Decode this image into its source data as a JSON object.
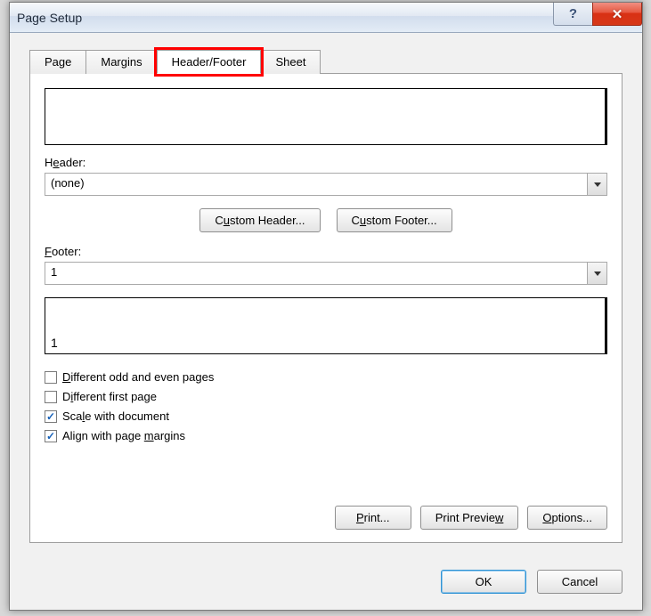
{
  "window": {
    "title": "Page Setup"
  },
  "tabs": {
    "page": "Page",
    "margins": "Margins",
    "header_footer": "Header/Footer",
    "sheet": "Sheet"
  },
  "header": {
    "label_pre": "H",
    "label_u": "e",
    "label_post": "ader:",
    "value": "(none)"
  },
  "custom_header": {
    "pre": "C",
    "u": "u",
    "post": "stom Header..."
  },
  "custom_footer": {
    "pre": "C",
    "u": "u",
    "post": "stom Footer..."
  },
  "footer": {
    "label_pre": "",
    "label_u": "F",
    "label_post": "ooter:",
    "value": "1",
    "preview": "1"
  },
  "checkboxes": {
    "diff_odd_even": {
      "pre": "",
      "u": "D",
      "post": "ifferent odd and even pages",
      "checked": false
    },
    "diff_first": {
      "pre": "D",
      "u": "i",
      "post": "fferent first page",
      "checked": false
    },
    "scale_doc": {
      "pre": "Sca",
      "u": "l",
      "post": "e with document",
      "checked": true
    },
    "align_margins": {
      "pre": "Align with page ",
      "u": "m",
      "post": "argins",
      "checked": true
    }
  },
  "buttons": {
    "print": {
      "pre": "",
      "u": "P",
      "post": "rint..."
    },
    "preview": {
      "pre": "Print Previe",
      "u": "w",
      "post": ""
    },
    "options": {
      "pre": "",
      "u": "O",
      "post": "ptions..."
    },
    "ok": "OK",
    "cancel": "Cancel"
  }
}
